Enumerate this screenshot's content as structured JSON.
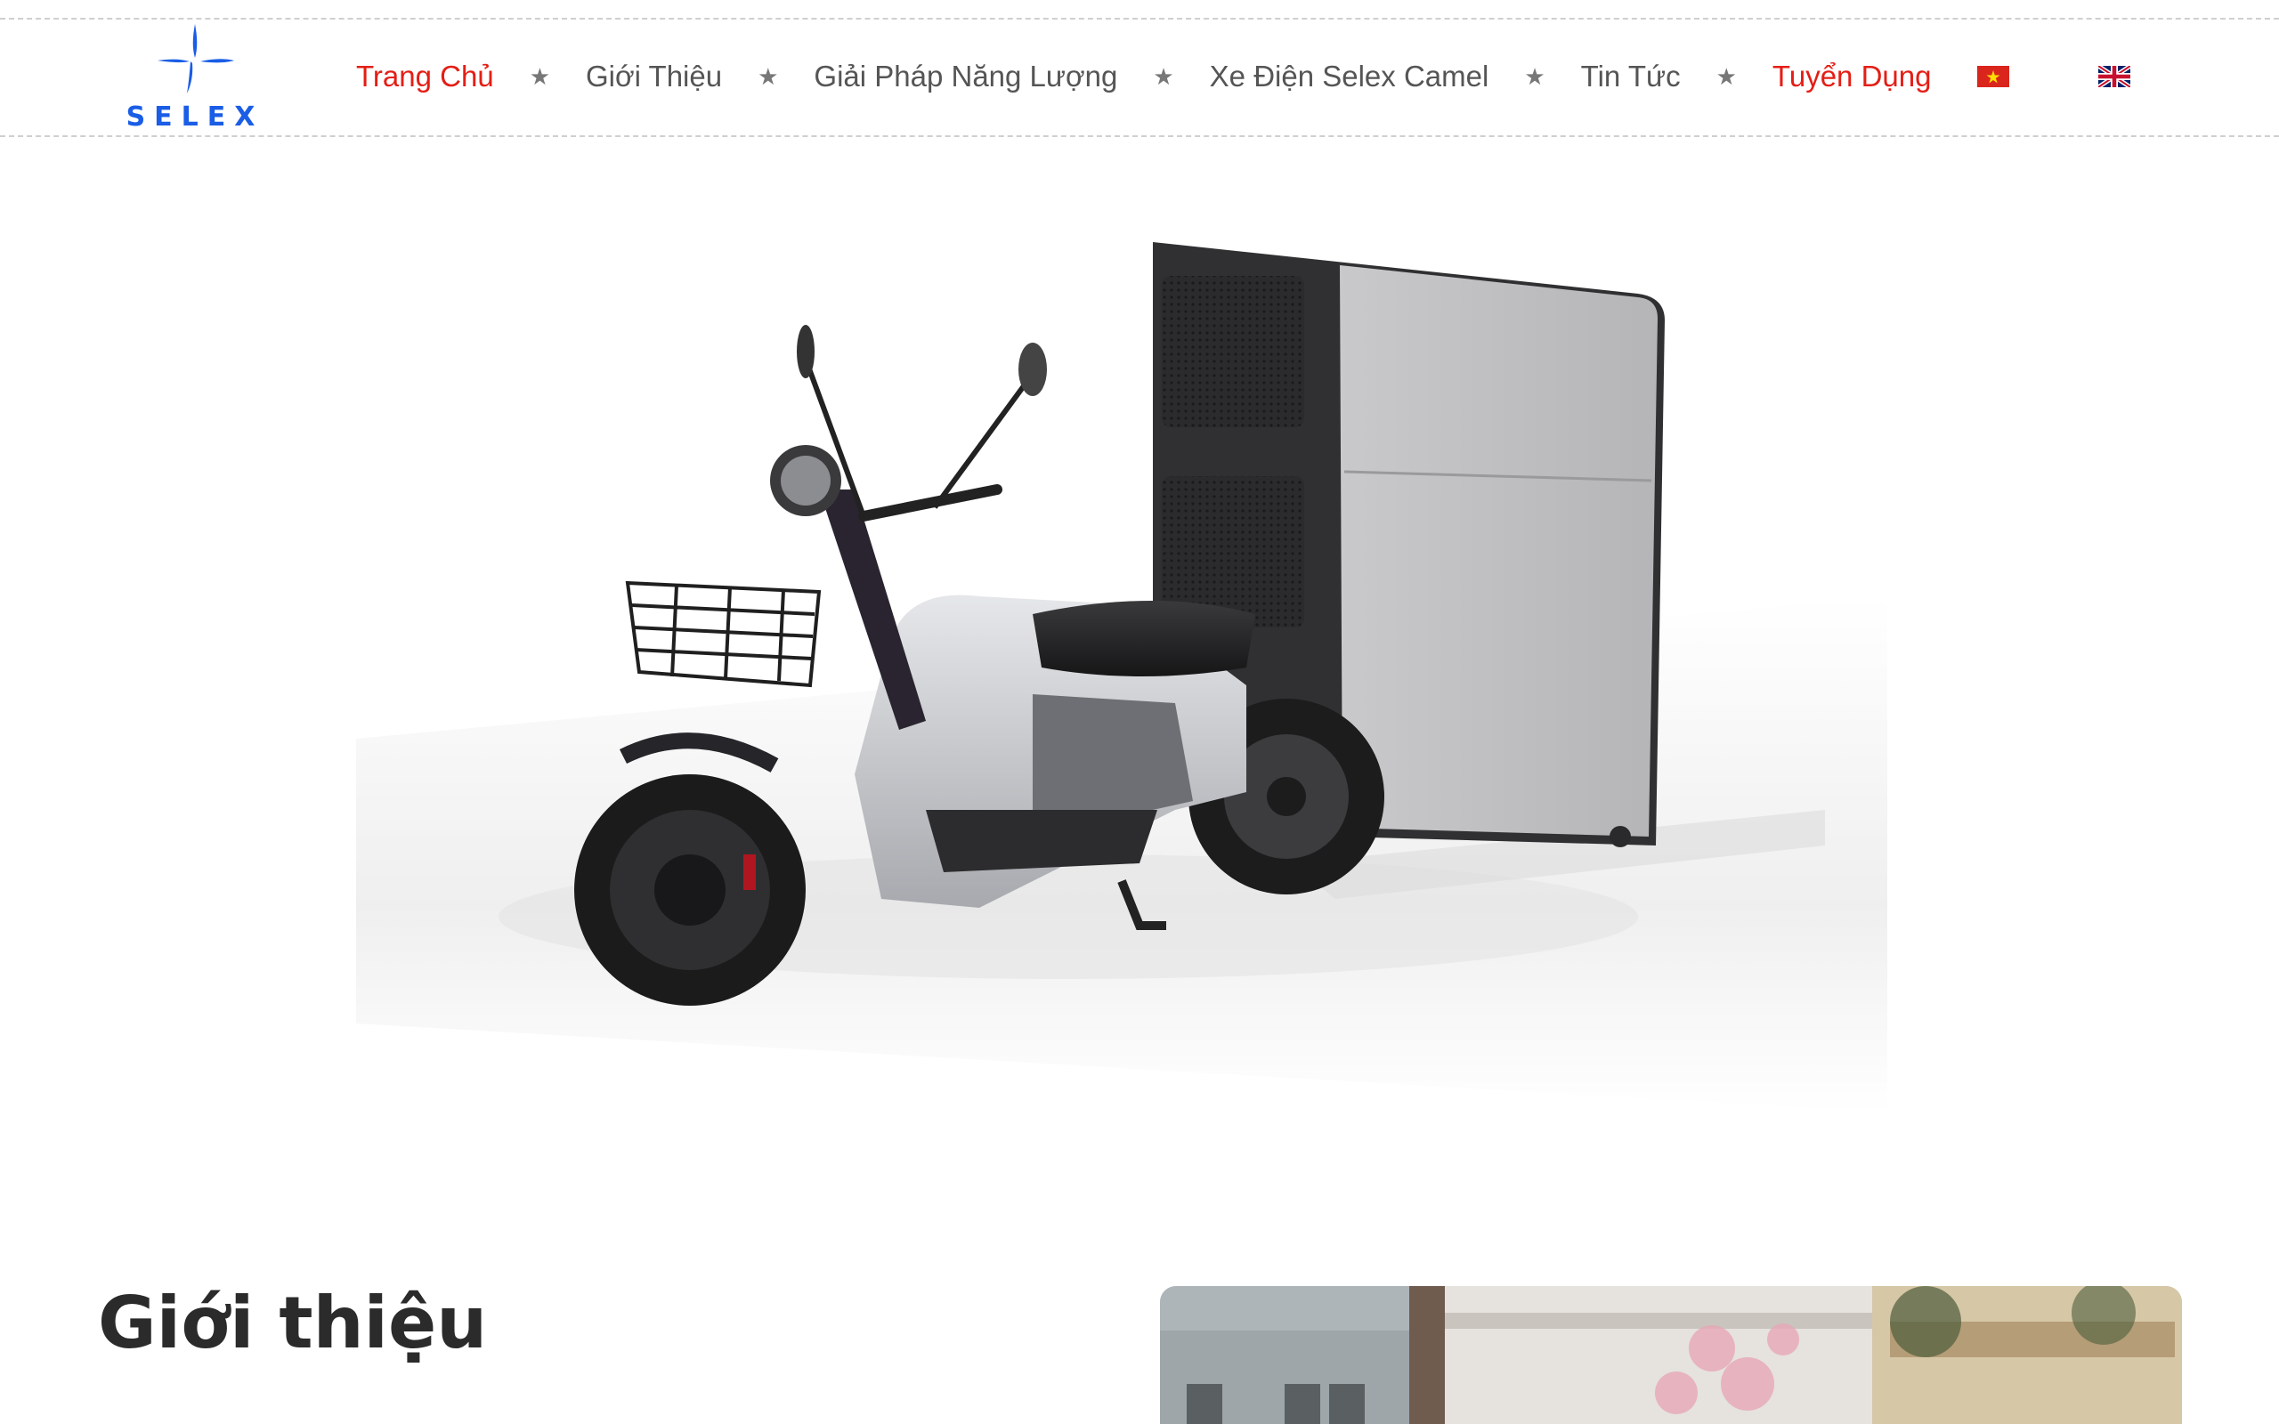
{
  "brand": {
    "logo_text": "SELEX",
    "accent": "#1a5de6"
  },
  "nav": {
    "items": [
      {
        "label": "Trang Chủ",
        "active": true
      },
      {
        "label": "Giới Thiệu",
        "active": false
      },
      {
        "label": "Giải Pháp Năng Lượng",
        "active": false
      },
      {
        "label": "Xe Điện Selex Camel",
        "active": false
      },
      {
        "label": "Tin Tức",
        "active": false
      },
      {
        "label": "Tuyển Dụng",
        "active": true
      }
    ],
    "separator": "★",
    "languages": [
      {
        "icon": "vietnam-flag-icon"
      },
      {
        "icon": "uk-flag-icon"
      }
    ],
    "active_color": "#e41e15",
    "text_color": "#555555"
  },
  "hero": {
    "image": "electric-cargo-scooter-image"
  },
  "about": {
    "title": "Giới thiệu",
    "image": "storefront-photo"
  }
}
